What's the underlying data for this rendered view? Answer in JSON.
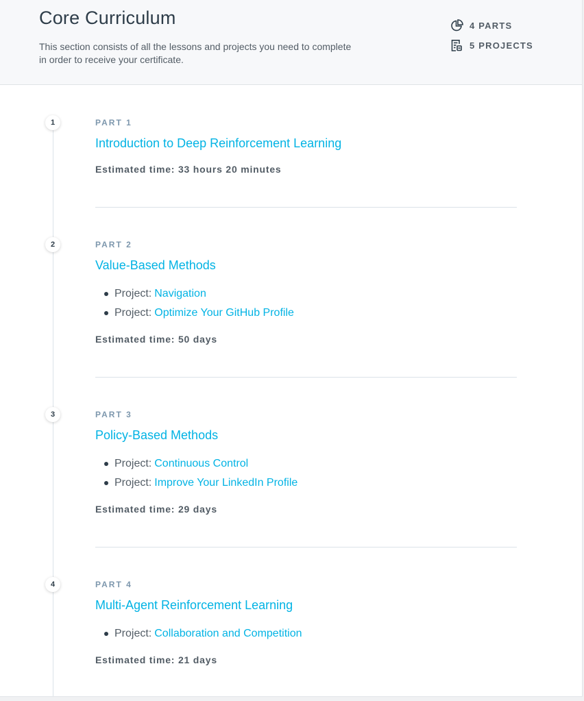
{
  "header": {
    "title": "Core Curriculum",
    "description": "This section consists of all the lessons and projects you need to complete in order to receive your certificate.",
    "parts_count": "4 PARTS",
    "projects_count": "5 PROJECTS",
    "parts_icon": "pie-chart-icon",
    "projects_icon": "document-icon"
  },
  "colors": {
    "link": "#02b3e4",
    "text": "#2e3d49",
    "muted": "#7d97ad",
    "header_bg": "#f7f8fa"
  },
  "parts": [
    {
      "number": "1",
      "label": "PART 1",
      "title": "Introduction to Deep Reinforcement Learning",
      "projects": [],
      "estimate": "Estimated time: 33 hours 20 minutes"
    },
    {
      "number": "2",
      "label": "PART 2",
      "title": "Value-Based Methods",
      "projects": [
        {
          "prefix": "Project:",
          "name": "Navigation"
        },
        {
          "prefix": "Project:",
          "name": "Optimize Your GitHub Profile"
        }
      ],
      "estimate": "Estimated time: 50 days"
    },
    {
      "number": "3",
      "label": "PART 3",
      "title": "Policy-Based Methods",
      "projects": [
        {
          "prefix": "Project:",
          "name": "Continuous Control"
        },
        {
          "prefix": "Project:",
          "name": "Improve Your LinkedIn Profile"
        }
      ],
      "estimate": "Estimated time: 29 days"
    },
    {
      "number": "4",
      "label": "PART 4",
      "title": "Multi-Agent Reinforcement Learning",
      "projects": [
        {
          "prefix": "Project:",
          "name": "Collaboration and Competition"
        }
      ],
      "estimate": "Estimated time: 21 days"
    }
  ]
}
